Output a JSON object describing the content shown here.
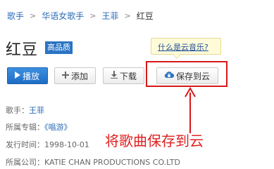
{
  "breadcrumb": {
    "items": [
      "歌手",
      "华语女歌手",
      "王菲"
    ],
    "current": "红豆",
    "separator": ">"
  },
  "song": {
    "title": "红豆",
    "badge": "高品质"
  },
  "tooltip": {
    "text": "什么是云音乐?"
  },
  "buttons": {
    "play": {
      "label": "播放",
      "icon": "play-icon"
    },
    "add": {
      "label": "添加",
      "icon": "plus-icon"
    },
    "download": {
      "label": "下载",
      "icon": "download-icon"
    },
    "save_cloud": {
      "label": "保存到云",
      "icon": "cloud-lock-icon"
    }
  },
  "meta": {
    "singer_label": "歌手：",
    "singer": "王菲",
    "album_label": "所属专辑：",
    "album": "《唱游》",
    "release_label": "发行时间：",
    "release": "1998-10-01",
    "company_label": "所属公司：",
    "company": "KATIE CHAN PRODUCTIONS CO.LTD"
  },
  "annotation": {
    "text": "将歌曲保存到云",
    "color": "#e02020"
  },
  "colors": {
    "link": "#2b6db8",
    "accent": "#2a74c4",
    "highlight": "#d71818"
  }
}
